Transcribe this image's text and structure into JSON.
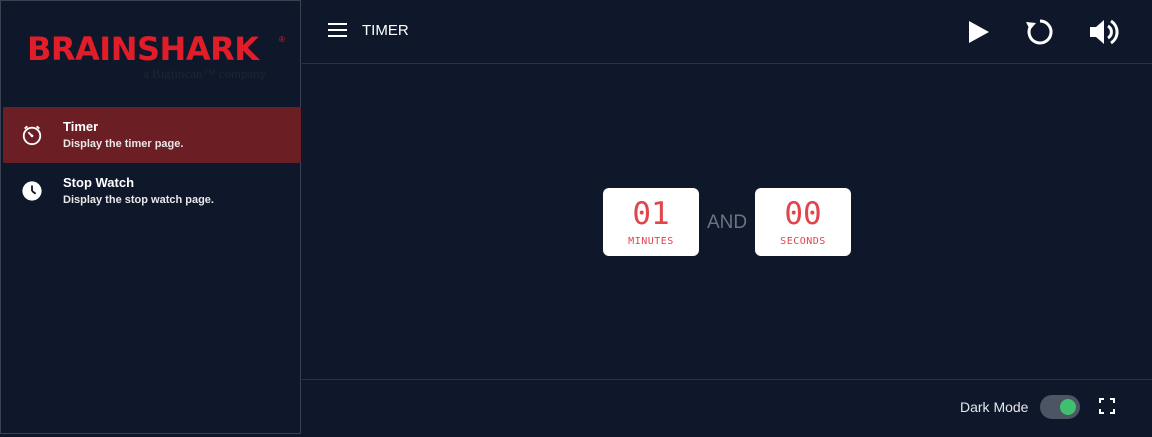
{
  "brand": {
    "name": "BRAINSHARK",
    "registered": "®",
    "tagline": "a Bigtincan™ company",
    "color": "#e11d2a"
  },
  "sidebar": {
    "items": [
      {
        "title": "Timer",
        "subtitle": "Display the timer page.",
        "icon": "timer-icon",
        "active": true
      },
      {
        "title": "Stop Watch",
        "subtitle": "Display the stop watch page.",
        "icon": "clock-icon",
        "active": false
      }
    ]
  },
  "header": {
    "title": "TIMER",
    "menu_icon": "menu-icon",
    "actions": [
      "play-icon",
      "restart-icon",
      "volume-icon"
    ]
  },
  "timer": {
    "minutes": "01",
    "minutes_label": "MINUTES",
    "separator": "AND",
    "seconds": "00",
    "seconds_label": "SECONDS",
    "digit_color": "#e0444c"
  },
  "footer": {
    "dark_mode_label": "Dark Mode",
    "dark_mode_on": true,
    "fullscreen_icon": "fullscreen-icon",
    "toggle_color": "#3fbf6f"
  },
  "colors": {
    "background": "#0f172a",
    "active_item": "#6b1f24"
  }
}
